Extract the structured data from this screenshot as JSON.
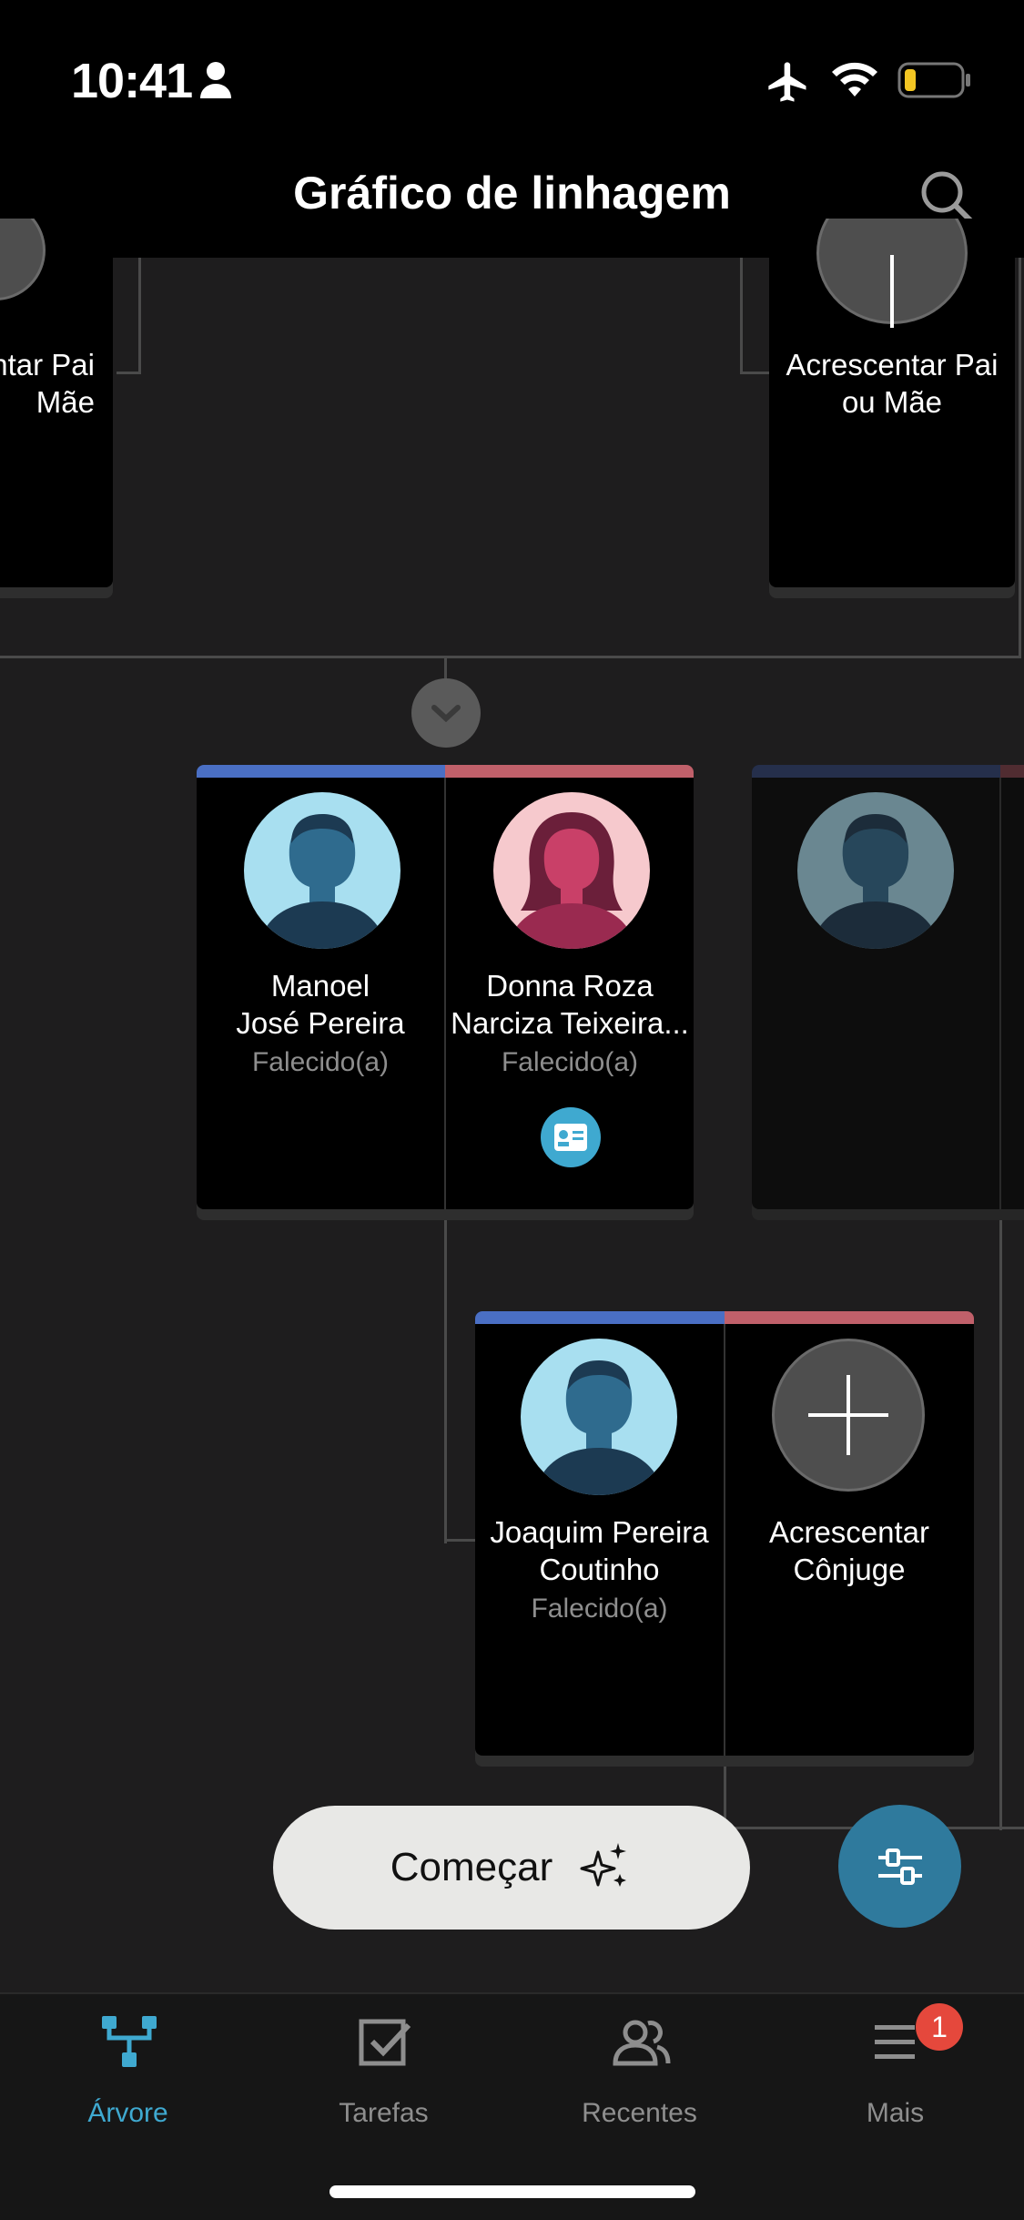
{
  "status_bar": {
    "time": "10:41"
  },
  "header": {
    "title": "Gráfico de linhagem"
  },
  "tree": {
    "add_parent_left": "ntar Pai\nMãe",
    "add_parent_right": "Acrescentar Pai\nou Mãe",
    "couple_top": {
      "husband": {
        "name": "Manoel\nJosé Pereira",
        "status": "Falecido(a)"
      },
      "wife": {
        "name": "Donna Roza\nNarciza Teixeira...",
        "status": "Falecido(a)"
      }
    },
    "couple_bottom": {
      "person": {
        "name": "Joaquim Pereira\nCoutinho",
        "status": "Falecido(a)"
      },
      "add_spouse": "Acrescentar\nCônjuge"
    }
  },
  "actions": {
    "start_label": "Começar"
  },
  "tabs": [
    {
      "label": "Árvore",
      "active": true
    },
    {
      "label": "Tarefas",
      "active": false
    },
    {
      "label": "Recentes",
      "active": false
    },
    {
      "label": "Mais",
      "active": false,
      "badge": "1"
    }
  ],
  "colors": {
    "accent": "#3fa9d0",
    "male_bar": "#4a6fc4",
    "female_bar": "#c0606a",
    "badge": "#e5483c",
    "fab": "#2f7a9d"
  }
}
